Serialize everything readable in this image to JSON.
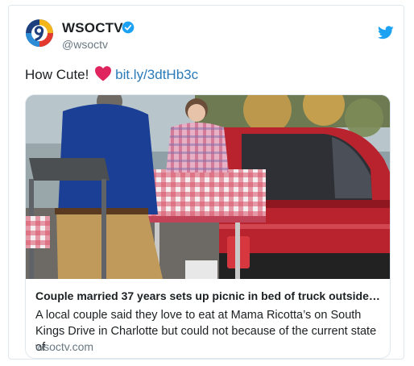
{
  "author": {
    "display_name": "WSOCTV",
    "handle": "@wsoctv",
    "avatar_icon": "wsoc-channel-9-logo",
    "verified_icon": "verified-badge-icon",
    "brand_icon": "twitter-bird-icon"
  },
  "tweet": {
    "text": "How Cute!",
    "emoji": "red-heart-icon",
    "link": "bit.ly/3dtHb3c"
  },
  "card": {
    "image": "couple-picnic-in-truck-bed-photo",
    "title": "Couple married 37 years sets up picnic in bed of truck outside…",
    "description": "A local couple said they love to eat at Mama Ricotta’s on South Kings Drive in Charlotte but could not because of the current state of",
    "domain": "wsoctv.com"
  },
  "colors": {
    "link": "#2b7bb9",
    "verified": "#1da1f2",
    "twitter_blue": "#1da1f2",
    "heart": "#e0245e",
    "text": "#1c2022",
    "muted": "#697882",
    "border": "#e1e8ed"
  }
}
